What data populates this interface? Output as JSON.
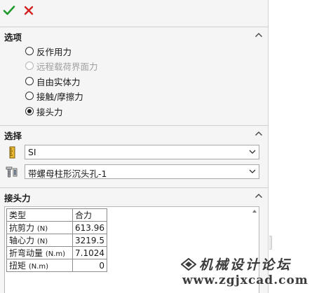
{
  "toolbar": {
    "ok_icon": "check-icon",
    "cancel_icon": "close-icon"
  },
  "options": {
    "title": "选项",
    "radios": [
      {
        "label": "反作用力",
        "checked": false,
        "disabled": false
      },
      {
        "label": "远程载荷界面力",
        "checked": false,
        "disabled": true
      },
      {
        "label": "自由实体力",
        "checked": false,
        "disabled": false
      },
      {
        "label": "接触/摩擦力",
        "checked": false,
        "disabled": false
      },
      {
        "label": "接头力",
        "checked": true,
        "disabled": false
      }
    ]
  },
  "selection": {
    "title": "选择",
    "units_value": "SI",
    "connector_value": "带螺母柱形沉头孔-1",
    "units_icon": "ruler-icon",
    "connector_icon": "bolt-icon"
  },
  "joint_forces": {
    "title": "接头力",
    "headers": [
      "类型",
      "合力"
    ],
    "rows": [
      {
        "name": "抗剪力",
        "unit": "(N)",
        "value": "613.96"
      },
      {
        "name": "轴心力",
        "unit": "(N)",
        "value": "3219.5"
      },
      {
        "name": "折弯动量",
        "unit": "(N.m)",
        "value": "7.1024"
      },
      {
        "name": "扭矩",
        "unit": "(N.m)",
        "value": "0"
      }
    ]
  },
  "watermark": {
    "text": "机械设计论坛",
    "url": "www.zgjxcad.com"
  },
  "colors": {
    "ok_green": "#1e9a2c",
    "cancel_red": "#d42020"
  }
}
